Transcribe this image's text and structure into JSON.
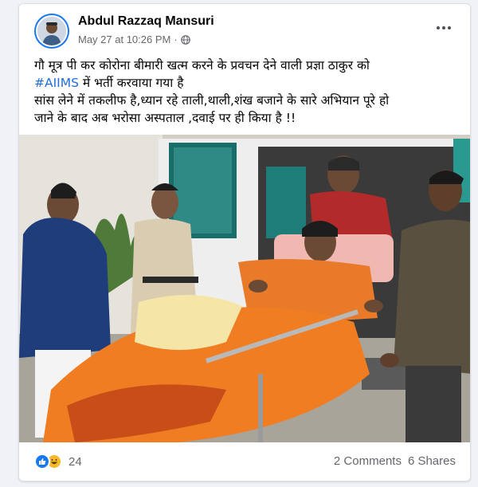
{
  "post": {
    "author": "Abdul Razzaq Mansuri",
    "timestamp": "May 27 at 10:26 PM",
    "separator": "·",
    "privacy_icon": "globe-icon",
    "more_icon": "more-options-icon",
    "text": {
      "line1": "गौ मूत्र पी कर कोरोना बीमारी खत्म करने के प्रवचन देने वाली प्रज्ञा ठाकुर को",
      "hashtag": "#AIIMS",
      "line2_rest": " में भर्ती करवाया गया है",
      "line3": "सांस लेने में तकलीफ है,ध्यान रहे ताली,थाली,शंख बजाने के सारे अभियान पूरे हो",
      "line4": "जाने के बाद अब भरोसा अस्पताल ,दवाई पर ही किया  है !!"
    }
  },
  "engagement": {
    "reaction_icons": [
      "like-icon",
      "haha-icon"
    ],
    "reaction_count": "24",
    "comments": "2 Comments",
    "shares": "6 Shares"
  },
  "colors": {
    "brand_blue": "#1877f2",
    "hashtag": "#216fdb",
    "secondary_text": "#65676b"
  }
}
